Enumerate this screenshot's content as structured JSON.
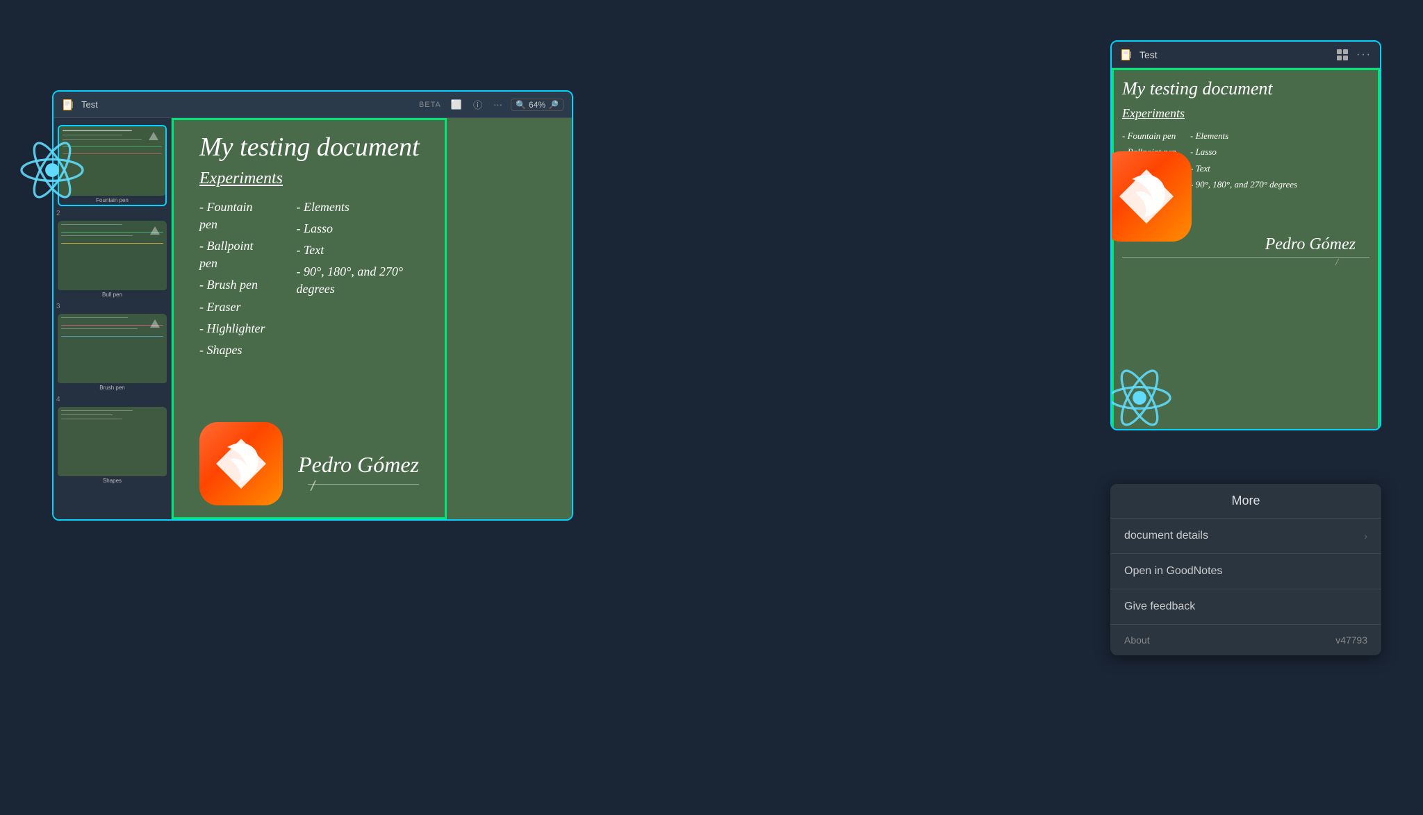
{
  "background_color": "#1a2535",
  "main_window": {
    "title": "Test",
    "badge": "BETA",
    "zoom_level": "64%",
    "border_color": "#00d4ff"
  },
  "right_window": {
    "title": "Test",
    "border_color": "#00d4ff"
  },
  "canvas": {
    "highlight_color": "#00e676",
    "title": "My testing document",
    "subtitle": "Experiments",
    "left_col": [
      "- Fountain pen",
      "- Ballpoint pen",
      "- Brush pen",
      "- Eraser",
      "- Highlighter",
      "- Shapes"
    ],
    "right_col": [
      "- Elements",
      "- Lasso",
      "- Text",
      "- 90°, 180°, and 270° degrees"
    ],
    "signature": "Pedro Gómez"
  },
  "sidebar": {
    "pages": [
      {
        "number": "",
        "label": "Fountain pen"
      },
      {
        "number": "2",
        "label": "Bull pen"
      },
      {
        "number": "3",
        "label": "Brush pen"
      },
      {
        "number": "4",
        "label": "Shapes"
      }
    ]
  },
  "more_menu": {
    "header": "More",
    "items": [
      {
        "label": "document details",
        "has_arrow": true
      },
      {
        "label": "Open in GoodNotes",
        "has_arrow": false
      },
      {
        "label": "Give feedback",
        "has_arrow": false
      },
      {
        "label": "About",
        "version": "v47793",
        "has_arrow": false
      }
    ]
  }
}
